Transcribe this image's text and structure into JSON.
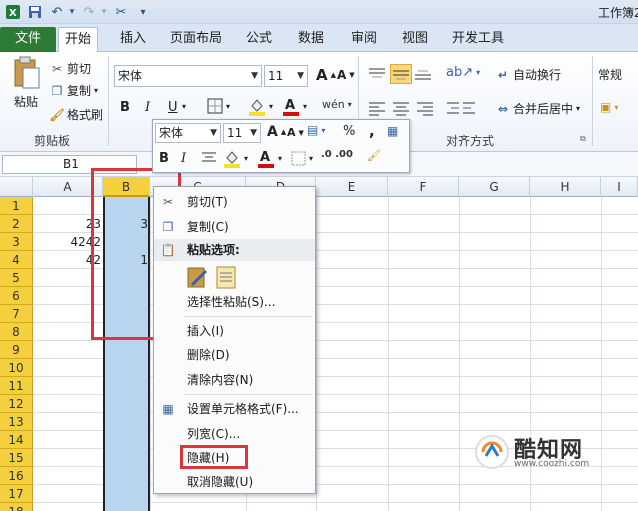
{
  "window": {
    "title": "工作簿2",
    "qat_icons": [
      "excel-logo-icon",
      "save-icon",
      "undo-icon",
      "redo-icon",
      "brush-icon",
      "customize-icon"
    ]
  },
  "tabs": [
    {
      "label": "文件"
    },
    {
      "label": "开始"
    },
    {
      "label": "插入"
    },
    {
      "label": "页面布局"
    },
    {
      "label": "公式"
    },
    {
      "label": "数据"
    },
    {
      "label": "审阅"
    },
    {
      "label": "视图"
    },
    {
      "label": "开发工具"
    }
  ],
  "ribbon": {
    "clipboard": {
      "paste_label": "粘贴",
      "cut_label": "剪切",
      "copy_label": "复制",
      "format_painter_label": "格式刷",
      "group_label": "剪贴板"
    },
    "font": {
      "name": "宋体",
      "size": "11",
      "bold": "B",
      "italic": "I",
      "underline": "U",
      "grow": "A",
      "shrink": "A"
    },
    "alignment": {
      "wrap_label": "自动换行",
      "merge_label": "合并后居中",
      "group_label": "对齐方式"
    },
    "number": {
      "format": "常规"
    },
    "colors": {
      "highlight": "#f5e02a",
      "font_color": "#d01010",
      "file_tab": "#2d7b35"
    }
  },
  "formula_bar": {
    "name_box": "B1"
  },
  "grid": {
    "columns": [
      "A",
      "B",
      "C",
      "D",
      "E",
      "F",
      "G",
      "H",
      "I"
    ],
    "rows": [
      "1",
      "2",
      "3",
      "4",
      "5",
      "6",
      "7",
      "8",
      "9",
      "10",
      "11",
      "12",
      "13",
      "14",
      "15",
      "16",
      "17",
      "18"
    ],
    "cells_a": [
      "",
      "23",
      "4242",
      "42",
      "",
      "",
      "",
      "",
      ""
    ],
    "cells_b": [
      "",
      "3",
      "",
      "1",
      "",
      "",
      "",
      "",
      ""
    ]
  },
  "mini_toolbar": {
    "font": "宋体",
    "size": "11",
    "percent": "%",
    "comma": ",",
    "bold": "B",
    "italic": "I",
    "grow": "A",
    "shrink": "A"
  },
  "context_menu": {
    "items": [
      {
        "label": "剪切(T)",
        "icon": "scissors-icon"
      },
      {
        "label": "复制(C)",
        "icon": "copy-icon"
      },
      {
        "label": "粘贴选项:",
        "icon": "paste-icon"
      },
      {
        "label": "选择性粘贴(S)...",
        "icon": ""
      },
      {
        "label": "插入(I)",
        "icon": ""
      },
      {
        "label": "删除(D)",
        "icon": ""
      },
      {
        "label": "清除内容(N)",
        "icon": ""
      },
      {
        "label": "设置单元格格式(F)...",
        "icon": "format-cells-icon"
      },
      {
        "label": "列宽(C)...",
        "icon": ""
      },
      {
        "label": "隐藏(H)",
        "icon": ""
      },
      {
        "label": "取消隐藏(U)",
        "icon": ""
      }
    ]
  },
  "watermark": {
    "brand": "酷知网",
    "url": "www.coozhi.com"
  }
}
